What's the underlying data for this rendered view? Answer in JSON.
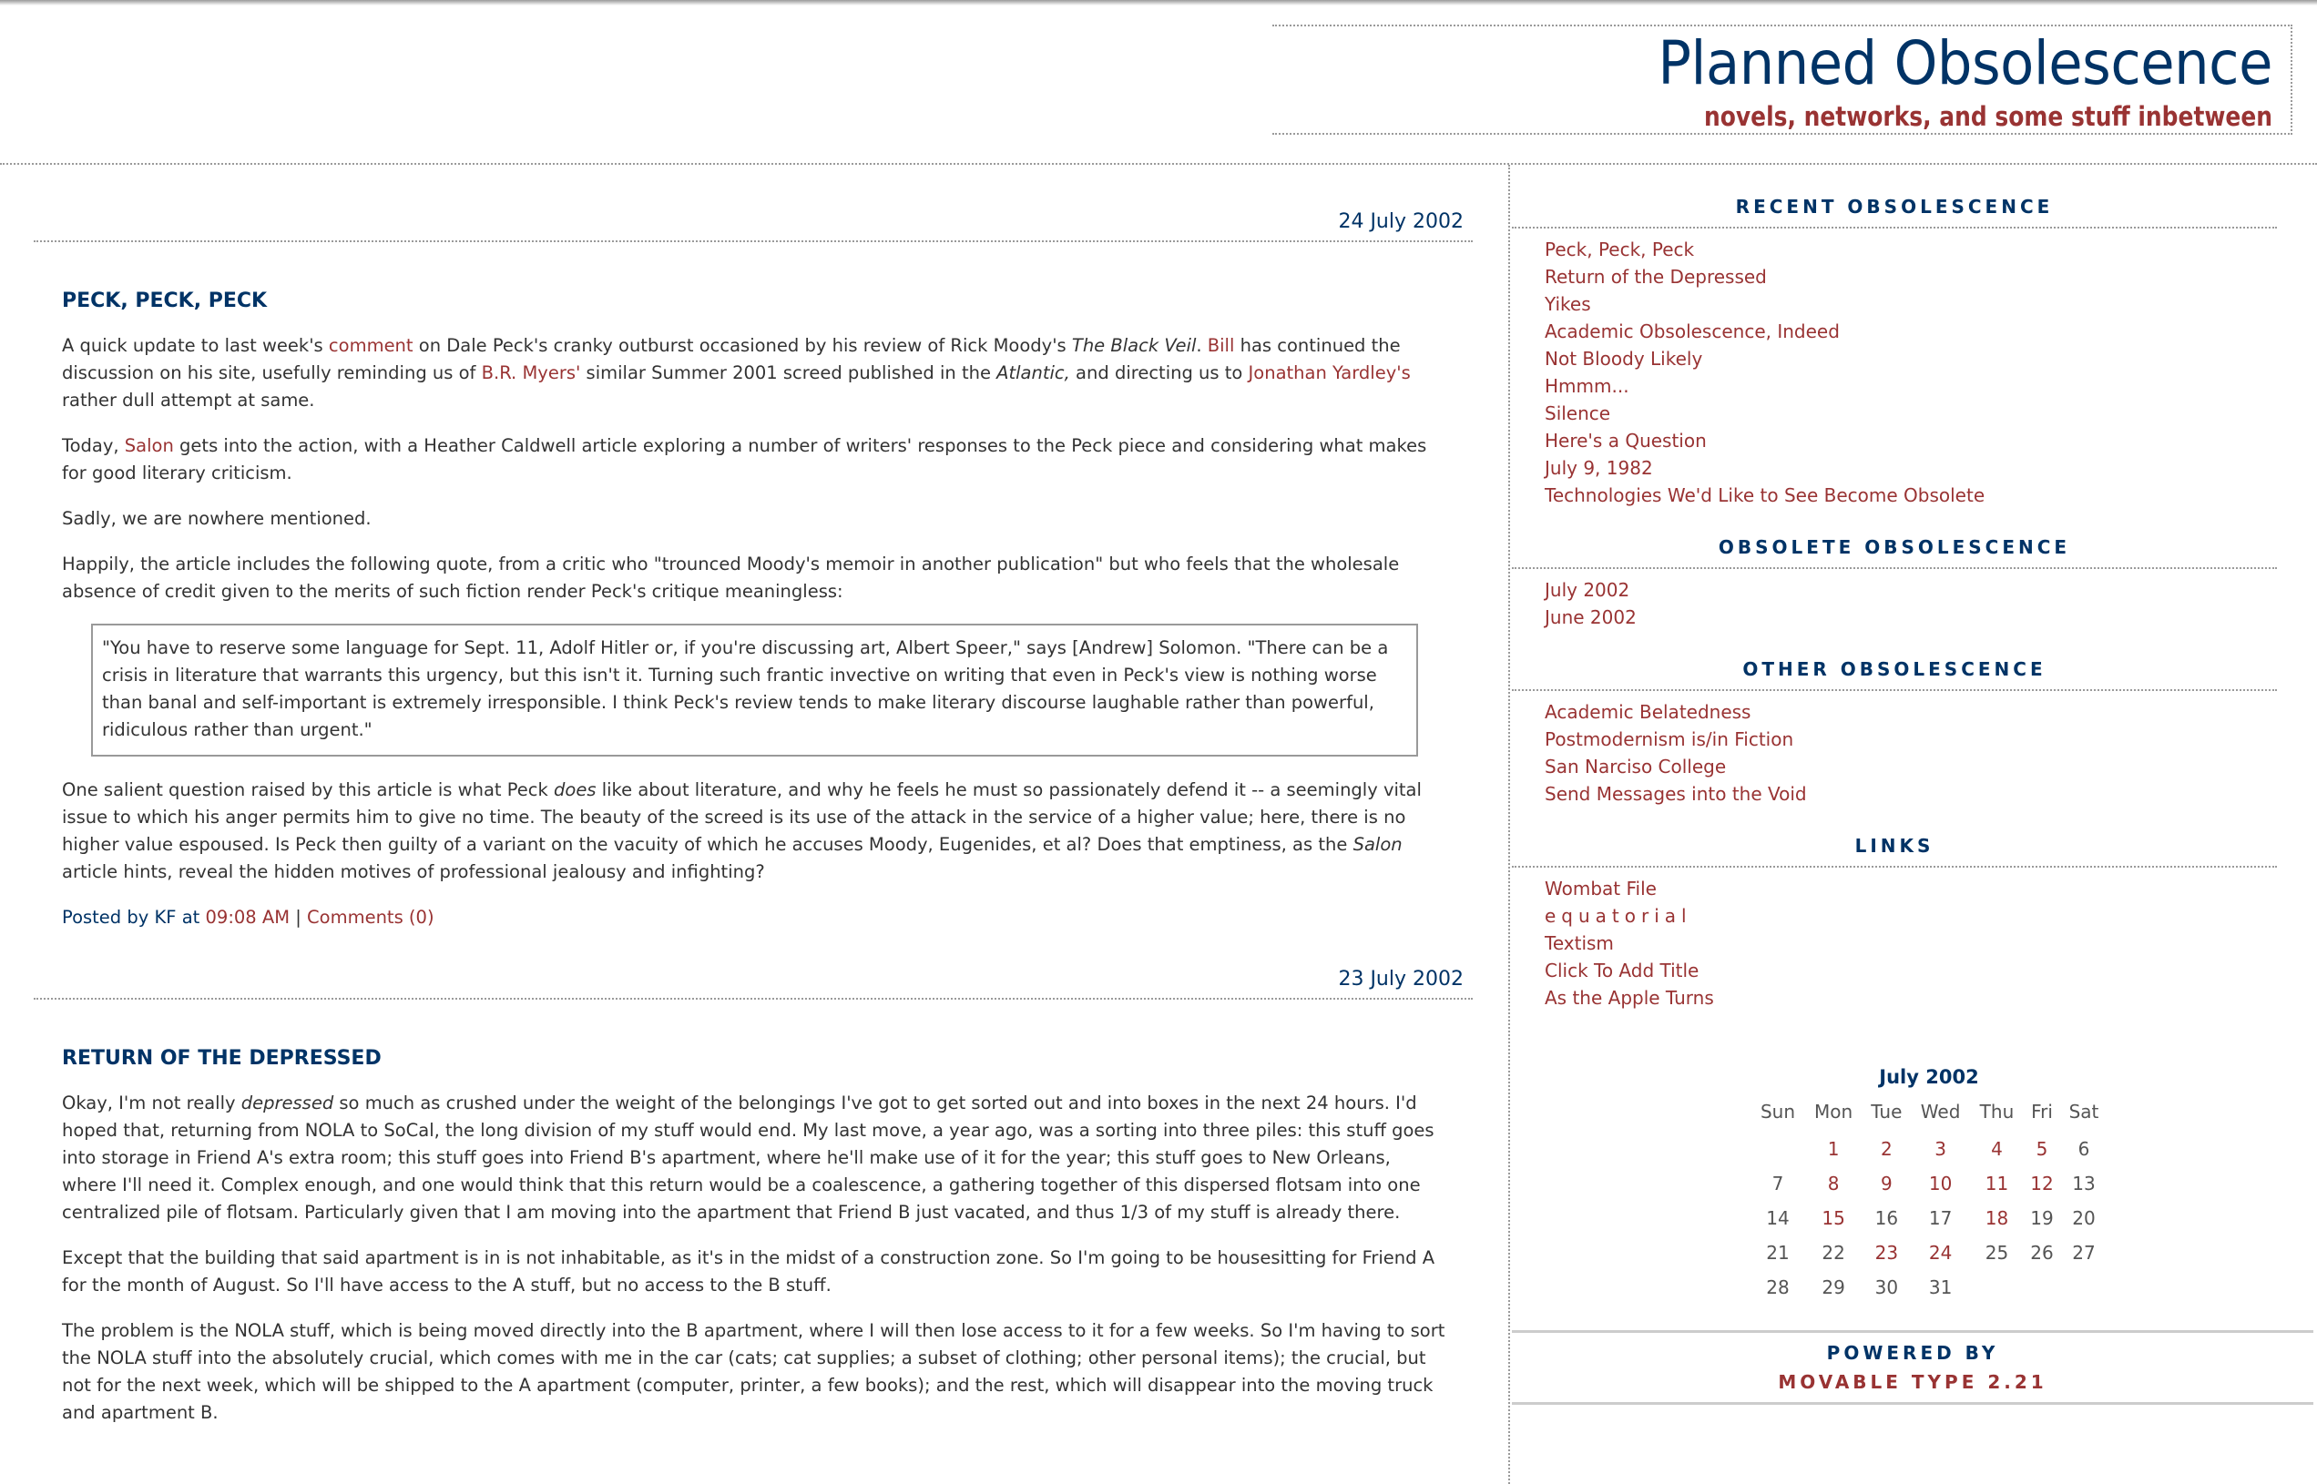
{
  "header": {
    "title": "Planned Obsolescence",
    "subtitle": "novels, networks, and some stuff inbetween"
  },
  "colors": {
    "navy": "#003366",
    "link": "#993333",
    "text": "#333333",
    "rule": "#9a9a9a"
  },
  "posts": [
    {
      "date": "24 July 2002",
      "title": "PECK, PECK, PECK",
      "p1": {
        "t1": "A quick update to last week's ",
        "l1": "comment",
        "t2": " on Dale Peck's cranky outburst occasioned by his review of Rick Moody's ",
        "i1": "The Black Veil",
        "t3": ". ",
        "l2": "Bill",
        "t4": " has continued the discussion on his site, usefully reminding us of ",
        "l3": "B.R. Myers'",
        "t5": " similar Summer 2001 screed published in the ",
        "i2": "Atlantic,",
        "t6": " and directing us to ",
        "l4": "Jonathan Yardley's",
        "t7": " rather dull attempt at same."
      },
      "p2": {
        "t1": "Today, ",
        "l1": "Salon",
        "t2": " gets into the action, with a Heather Caldwell article exploring a number of writers' responses to the Peck piece and considering what makes for good literary criticism."
      },
      "p3": "Sadly, we are nowhere mentioned.",
      "p4": "Happily, the article includes the following quote, from a critic who \"trounced Moody's memoir in another publication\" but who feels that the wholesale absence of credit given to the merits of such fiction render Peck's critique meaningless:",
      "quote": "\"You have to reserve some language for Sept. 11, Adolf Hitler or, if you're discussing art, Albert Speer,\" says [Andrew] Solomon. \"There can be a crisis in literature that warrants this urgency, but this isn't it. Turning such frantic invective on writing that even in Peck's view is nothing worse than banal and self-important is extremely irresponsible. I think Peck's review tends to make literary discourse laughable rather than powerful, ridiculous rather than urgent.\"",
      "p5": {
        "t1": "One salient question raised by this article is what Peck ",
        "i1": "does",
        "t2": " like about literature, and why he feels he must so passionately defend it -- a seemingly vital issue to which his anger permits him to give no time. The beauty of the screed is its use of the attack in the service of a higher value; here, there is no higher value espoused. Is Peck then guilty of a variant on the vacuity of which he accuses Moody, Eugenides, et al? Does that emptiness, as the ",
        "i2": "Salon",
        "t3": " article hints, reveal the hidden motives of professional jealousy and infighting?"
      },
      "footer": {
        "posted_by": "Posted by KF at ",
        "time": "09:08 AM",
        "sep": " | ",
        "comments": "Comments (0)"
      }
    },
    {
      "date": "23 July 2002",
      "title": "RETURN OF THE DEPRESSED",
      "p1": {
        "t1": "Okay, I'm not really ",
        "i1": "depressed",
        "t2": " so much as crushed under the weight of the belongings I've got to get sorted out and into boxes in the next 24 hours. I'd hoped that, returning from NOLA to SoCal, the long division of my stuff would end. My last move, a year ago, was a sorting into three piles: this stuff goes into storage in Friend A's extra room; this stuff goes into Friend B's apartment, where he'll make use of it for the year; this stuff goes to New Orleans, where I'll need it. Complex enough, and one would think that this return would be a coalescence, a gathering together of this dispersed flotsam into one centralized pile of flotsam. Particularly given that I am moving into the apartment that Friend B just vacated, and thus 1/3 of my stuff is already there."
      },
      "p2": "Except that the building that said apartment is in is not inhabitable, as it's in the midst of a construction zone. So I'm going to be housesitting for Friend A for the month of August. So I'll have access to the A stuff, but no access to the B stuff.",
      "p3": "The problem is the NOLA stuff, which is being moved directly into the B apartment, where I will then lose access to it for a few weeks. So I'm having to sort the NOLA stuff into the absolutely crucial, which comes with me in the car (cats; cat supplies; a subset of clothing; other personal items); the crucial, but not for the next week, which will be shipped to the A apartment (computer, printer, a few books); and the rest, which will disappear into the moving truck and apartment B."
    }
  ],
  "sidebar": {
    "recent": {
      "heading": "RECENT OBSOLESCENCE",
      "items": [
        "Peck, Peck, Peck",
        "Return of the Depressed",
        "Yikes",
        "Academic Obsolescence, Indeed",
        "Not Bloody Likely",
        "Hmmm...",
        "Silence",
        "Here's a Question",
        "July 9, 1982",
        "Technologies We'd Like to See Become Obsolete"
      ]
    },
    "archives": {
      "heading": "OBSOLETE OBSOLESCENCE",
      "items": [
        "July 2002",
        "June 2002"
      ]
    },
    "other": {
      "heading": "OTHER OBSOLESCENCE",
      "items": [
        "Academic Belatedness",
        "Postmodernism is/in Fiction",
        "San Narciso College",
        "Send Messages into the Void"
      ]
    },
    "links": {
      "heading": "LINKS",
      "items": [
        "Wombat File",
        "equatorial",
        "Textism",
        "Click To Add Title",
        "As the Apple Turns"
      ]
    },
    "calendar": {
      "title": "July 2002",
      "weekdays": [
        "Sun",
        "Mon",
        "Tue",
        "Wed",
        "Thu",
        "Fri",
        "Sat"
      ],
      "first_weekday_index": 1,
      "days_in_month": 31,
      "linked_days": [
        1,
        2,
        3,
        4,
        5,
        8,
        9,
        10,
        11,
        12,
        15,
        18,
        23,
        24
      ]
    },
    "powered": {
      "line1": "POWERED BY",
      "line2": "MOVABLE TYPE 2.21"
    }
  }
}
